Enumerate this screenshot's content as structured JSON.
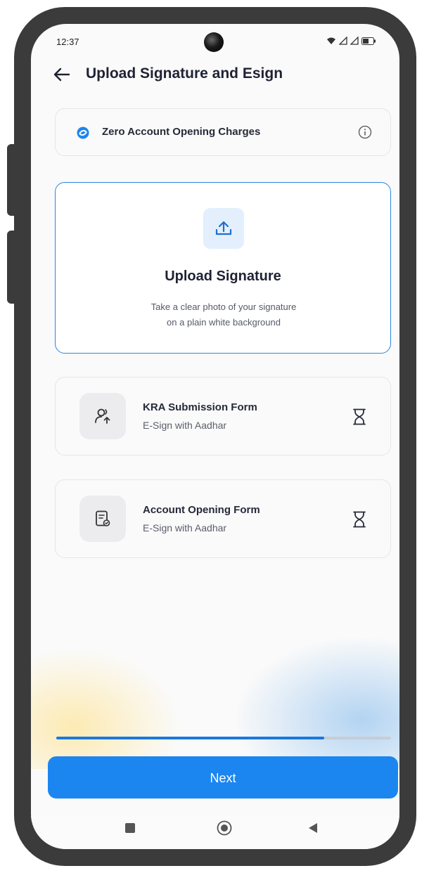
{
  "status_bar": {
    "time": "12:37"
  },
  "header": {
    "title": "Upload Signature and Esign"
  },
  "banner": {
    "text": "Zero Account Opening Charges"
  },
  "upload": {
    "title": "Upload Signature",
    "description_line1": "Take a clear photo of your signature",
    "description_line2": "on a plain white background"
  },
  "forms": [
    {
      "title": "KRA Submission Form",
      "subtitle": "E-Sign with Aadhar",
      "icon": "user-upload-icon",
      "status_icon": "hourglass-icon"
    },
    {
      "title": "Account Opening Form",
      "subtitle": "E-Sign with Aadhar",
      "icon": "document-icon",
      "status_icon": "hourglass-icon"
    }
  ],
  "progress": {
    "value": 0.8
  },
  "footer": {
    "next_label": "Next"
  },
  "colors": {
    "accent": "#1b86f0",
    "border_active": "#2b86e0",
    "text_primary": "#1e2233"
  }
}
